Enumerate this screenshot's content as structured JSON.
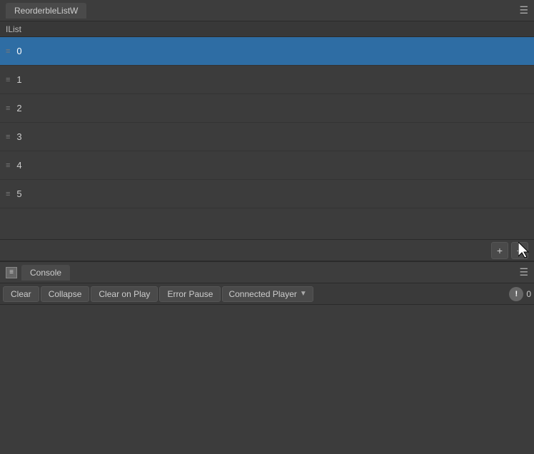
{
  "topPanel": {
    "title": "ReorderbleListW",
    "menuIcon": "☰",
    "listHeader": "IList",
    "items": [
      {
        "id": 0,
        "label": "0",
        "selected": true
      },
      {
        "id": 1,
        "label": "1",
        "selected": false
      },
      {
        "id": 2,
        "label": "2",
        "selected": false
      },
      {
        "id": 3,
        "label": "3",
        "selected": false
      },
      {
        "id": 4,
        "label": "4",
        "selected": false
      },
      {
        "id": 5,
        "label": "5",
        "selected": false
      }
    ],
    "addButtonLabel": "+",
    "removeButtonLabel": "−"
  },
  "consolePanel": {
    "title": "Console",
    "consoleIconLabel": "≡",
    "menuIcon": "☰",
    "toolbar": {
      "clearLabel": "Clear",
      "collapseLabel": "Collapse",
      "clearOnPlayLabel": "Clear on Play",
      "errorPauseLabel": "Error Pause",
      "connectedPlayerLabel": "Connected Player",
      "warningCount": "0"
    }
  }
}
